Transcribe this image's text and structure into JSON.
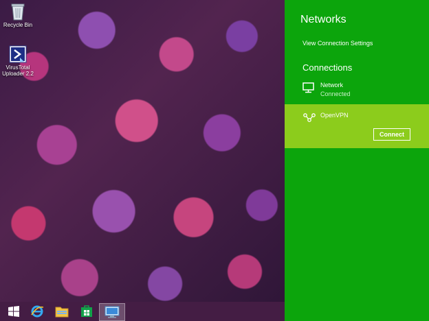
{
  "desktop": {
    "icons": [
      {
        "label": "Recycle Bin",
        "icon": "recycle-bin-icon"
      },
      {
        "label": "VirusTotal Uploader 2.2",
        "icon": "virustotal-uploader-icon"
      }
    ]
  },
  "taskbar": {
    "buttons": [
      {
        "icon": "windows-start-icon"
      },
      {
        "icon": "internet-explorer-icon"
      },
      {
        "icon": "file-explorer-icon"
      },
      {
        "icon": "store-icon"
      },
      {
        "icon": "remote-desktop-icon"
      }
    ]
  },
  "panel": {
    "title": "Networks",
    "view_settings_label": "View Connection Settings",
    "connections_heading": "Connections",
    "items": [
      {
        "name": "Network",
        "status": "Connected",
        "icon": "wired-network-icon"
      },
      {
        "name": "OpenVPN",
        "icon": "vpn-network-icon",
        "action_label": "Connect"
      }
    ]
  },
  "colors": {
    "panel_bg": "#0ca50c",
    "selected_item_bg": "#8ccc1c"
  }
}
